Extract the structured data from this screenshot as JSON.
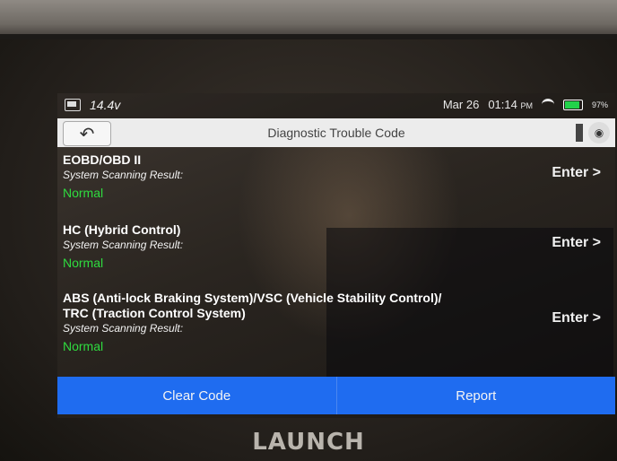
{
  "status": {
    "voltage": "14.4v",
    "date": "Mar 26",
    "time": "01:14",
    "ampm": "PM",
    "battery": "97%"
  },
  "titlebar": {
    "title": "Diagnostic Trouble Code"
  },
  "systems": [
    {
      "name": "EOBD/OBD II",
      "label": "System Scanning Result:",
      "result": "Normal",
      "enter": "Enter >"
    },
    {
      "name": "HC (Hybrid Control)",
      "label": "System Scanning Result:",
      "result": "Normal",
      "enter": "Enter >"
    },
    {
      "name": "ABS (Anti-lock Braking System)/VSC (Vehicle Stability Control)/",
      "name2": "TRC (Traction Control System)",
      "label": "System Scanning Result:",
      "result": "Normal",
      "enter": "Enter >"
    }
  ],
  "actions": {
    "clear": "Clear Code",
    "report": "Report"
  },
  "brand": "LAUNCH",
  "colors": {
    "accent": "#1f6cf0",
    "normal": "#2fdc3f"
  },
  "icons": [
    "back-arrow-icon",
    "flag-icon",
    "camera-icon",
    "wifi-icon",
    "battery-icon",
    "vehicle-battery-icon"
  ]
}
